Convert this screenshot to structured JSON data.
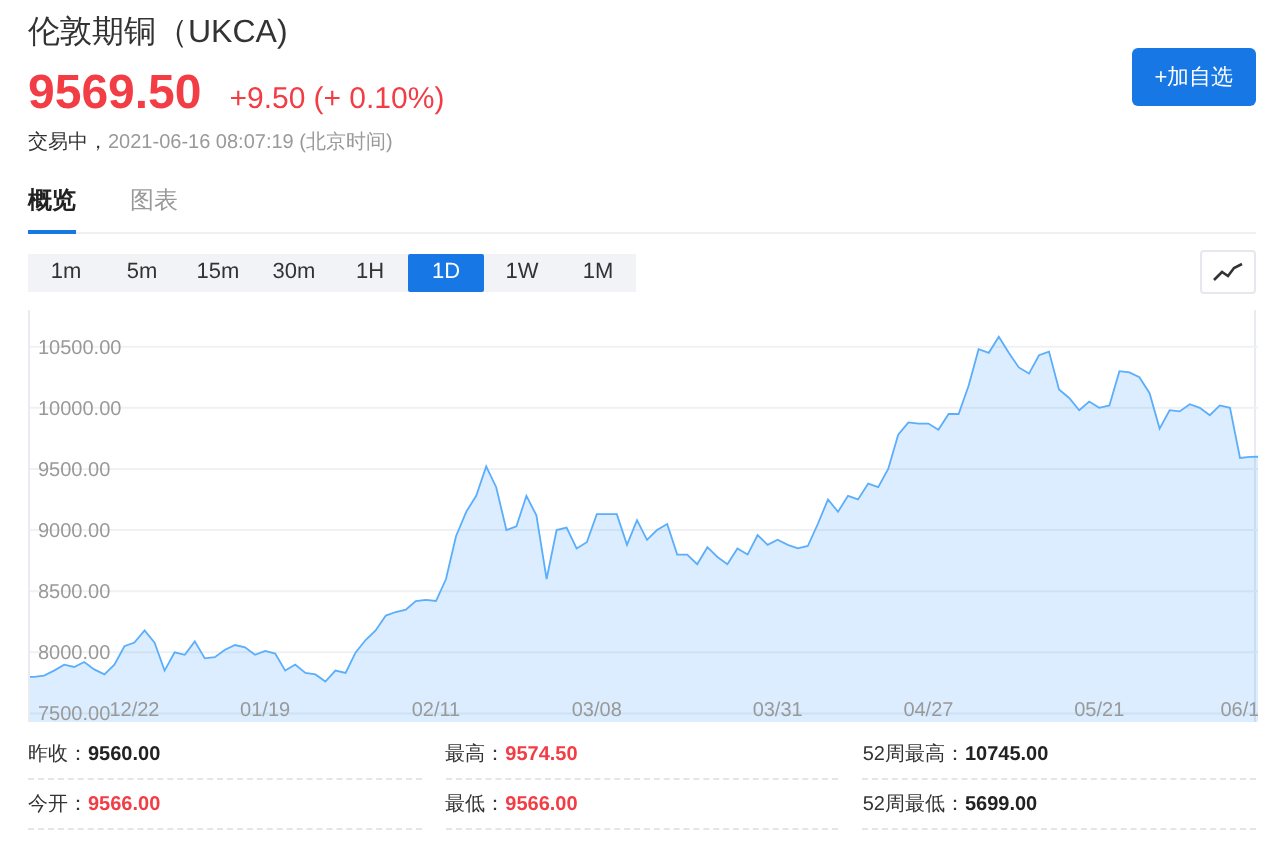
{
  "header": {
    "title": "伦敦期铜（UKCA)",
    "price": "9569.50",
    "change": "+9.50",
    "change_pct": "(+ 0.10%)",
    "color": "#f23d45",
    "status": "交易中，",
    "timestamp": "2021-06-16 08:07:19 (北京时间)",
    "watch_button": "+加自选"
  },
  "tabs": [
    {
      "label": "概览",
      "selected": true
    },
    {
      "label": "图表",
      "selected": false
    }
  ],
  "periods": [
    {
      "label": "1m",
      "selected": false
    },
    {
      "label": "5m",
      "selected": false
    },
    {
      "label": "15m",
      "selected": false
    },
    {
      "label": "30m",
      "selected": false
    },
    {
      "label": "1H",
      "selected": false
    },
    {
      "label": "1D",
      "selected": true
    },
    {
      "label": "1W",
      "selected": false
    },
    {
      "label": "1M",
      "selected": false
    }
  ],
  "chart": {
    "chart_data": {
      "type": "area",
      "categories": [
        null,
        null,
        null,
        null,
        null,
        null,
        null,
        null,
        null,
        null,
        "12/22",
        null,
        null,
        null,
        null,
        null,
        null,
        null,
        null,
        null,
        null,
        null,
        null,
        "01/19",
        null,
        null,
        null,
        null,
        null,
        null,
        null,
        null,
        null,
        null,
        null,
        null,
        null,
        null,
        null,
        null,
        "02/11",
        null,
        null,
        null,
        null,
        null,
        null,
        null,
        null,
        null,
        null,
        null,
        null,
        null,
        null,
        null,
        "03/08",
        null,
        null,
        null,
        null,
        null,
        null,
        null,
        null,
        null,
        null,
        null,
        null,
        null,
        null,
        null,
        null,
        null,
        "03/31",
        null,
        null,
        null,
        null,
        null,
        null,
        null,
        null,
        null,
        null,
        null,
        null,
        null,
        null,
        "04/27",
        null,
        null,
        null,
        null,
        null,
        null,
        null,
        null,
        null,
        null,
        null,
        null,
        null,
        null,
        null,
        null,
        "05/21",
        null,
        null,
        null,
        null,
        null,
        null,
        null,
        null,
        null,
        null,
        null,
        null,
        null,
        "06/1",
        null
      ],
      "series": [
        {
          "color": "#5aaefc",
          "values": [
            7800,
            7810,
            7850,
            7900,
            7880,
            7920,
            7860,
            7820,
            7900,
            8050,
            8080,
            8180,
            8080,
            7850,
            8000,
            7980,
            8090,
            7950,
            7960,
            8020,
            8060,
            8040,
            7980,
            8010,
            7990,
            7850,
            7900,
            7830,
            7820,
            7760,
            7850,
            7830,
            8000,
            8100,
            8180,
            8300,
            8330,
            8350,
            8420,
            8430,
            8420,
            8600,
            8950,
            9150,
            9280,
            9520,
            9350,
            9000,
            9030,
            9280,
            9120,
            8600,
            9000,
            9020,
            8850,
            8900,
            9130,
            9130,
            9130,
            8880,
            9080,
            8920,
            9000,
            9050,
            8800,
            8800,
            8720,
            8860,
            8780,
            8720,
            8850,
            8800,
            8960,
            8880,
            8920,
            8880,
            8850,
            8870,
            9050,
            9250,
            9150,
            9280,
            9250,
            9380,
            9350,
            9500,
            9780,
            9880,
            9870,
            9870,
            9820,
            9950,
            9950,
            10180,
            10480,
            10450,
            10580,
            10450,
            10330,
            10280,
            10430,
            10460,
            10150,
            10080,
            9980,
            10050,
            10000,
            10020,
            10300,
            10290,
            10250,
            10120,
            9830,
            9980,
            9970,
            10030,
            10000,
            9940,
            10020,
            10000,
            9590,
            9600
          ]
        }
      ],
      "ylim": [
        7430,
        10800
      ],
      "grid": true,
      "yticks": [
        {
          "value": 7500,
          "label": "7500.00"
        },
        {
          "value": 8000,
          "label": "8000.00"
        },
        {
          "value": 8500,
          "label": "8500.00"
        },
        {
          "value": 9000,
          "label": "9000.00"
        },
        {
          "value": 9500,
          "label": "9500.00"
        },
        {
          "value": 10000,
          "label": "10000.00"
        },
        {
          "value": 10500,
          "label": "10500.00"
        }
      ]
    }
  },
  "stats": [
    {
      "label": "昨收：",
      "value": "9560.00",
      "color": "#222222"
    },
    {
      "label": "最高：",
      "value": "9574.50",
      "color": "#f23d45"
    },
    {
      "label": "52周最高：",
      "value": "10745.00",
      "color": "#222222"
    },
    {
      "label": "今开：",
      "value": "9566.00",
      "color": "#f23d45"
    },
    {
      "label": "最低：",
      "value": "9566.00",
      "color": "#f23d45"
    },
    {
      "label": "52周最低：",
      "value": "5699.00",
      "color": "#222222"
    }
  ]
}
